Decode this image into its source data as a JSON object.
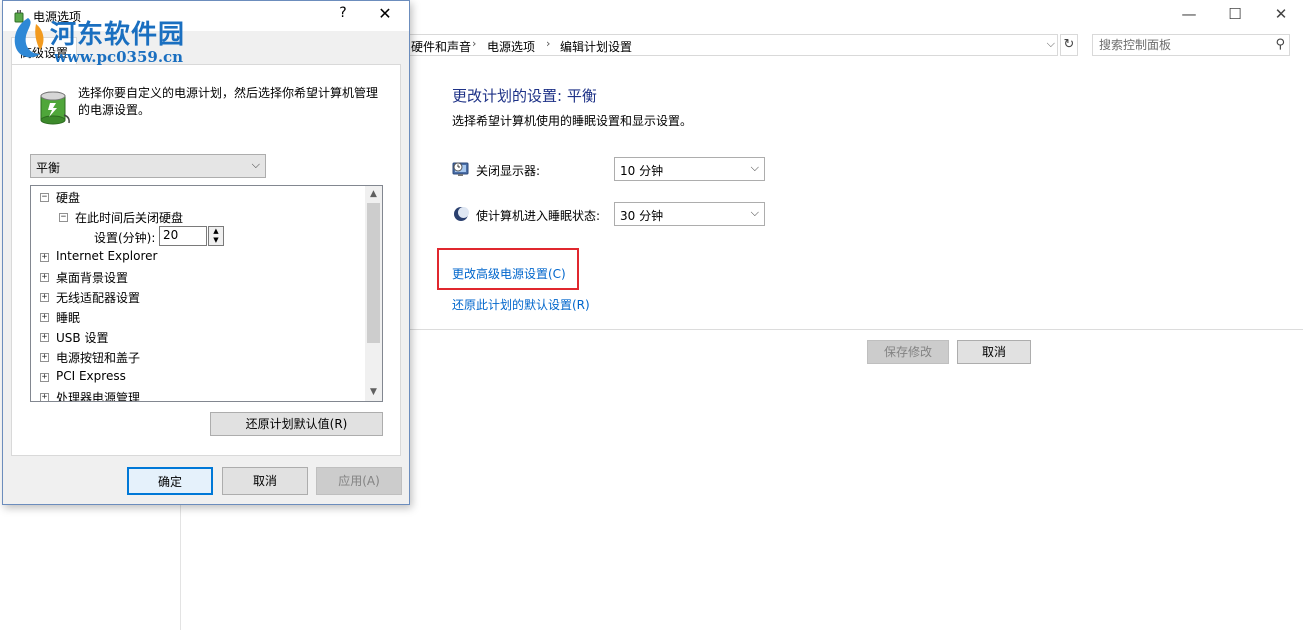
{
  "main": {
    "window_controls": {
      "minimize": "—",
      "maximize": "☐",
      "close": "✕"
    },
    "breadcrumbs": [
      "硬件和声音",
      "电源选项",
      "编辑计划设置"
    ],
    "search": {
      "placeholder": "搜索控制面板"
    },
    "title": "更改计划的设置: 平衡",
    "subtitle": "选择希望计算机使用的睡眠设置和显示设置。",
    "settings": [
      {
        "label": "关闭显示器:",
        "value": "10 分钟",
        "icon": "monitor-clock-icon"
      },
      {
        "label": "使计算机进入睡眠状态:",
        "value": "30 分钟",
        "icon": "moon-icon"
      }
    ],
    "links": {
      "advanced": "更改高级电源设置(C)",
      "restore": "还原此计划的默认设置(R)"
    },
    "buttons": {
      "save": "保存修改",
      "cancel": "取消"
    }
  },
  "dialog": {
    "title": "电源选项",
    "help": "?",
    "close": "✕",
    "tab": "高级设置",
    "description": "选择你要自定义的电源计划，然后选择你希望计算机管理的电源设置。",
    "plan": "平衡",
    "tree": {
      "harddisk": "硬盘",
      "harddisk_sub": "在此时间后关闭硬盘",
      "setting_label": "设置(分钟):",
      "setting_value": "20",
      "items": [
        "Internet Explorer",
        "桌面背景设置",
        "无线适配器设置",
        "睡眠",
        "USB 设置",
        "电源按钮和盖子",
        "PCI Express",
        "处理器电源管理"
      ]
    },
    "restore_button": "还原计划默认值(R)",
    "ok": "确定",
    "cancel": "取消",
    "apply": "应用(A)"
  },
  "watermark": {
    "name": "河东软件园",
    "url": "www.pc0359.cn"
  }
}
